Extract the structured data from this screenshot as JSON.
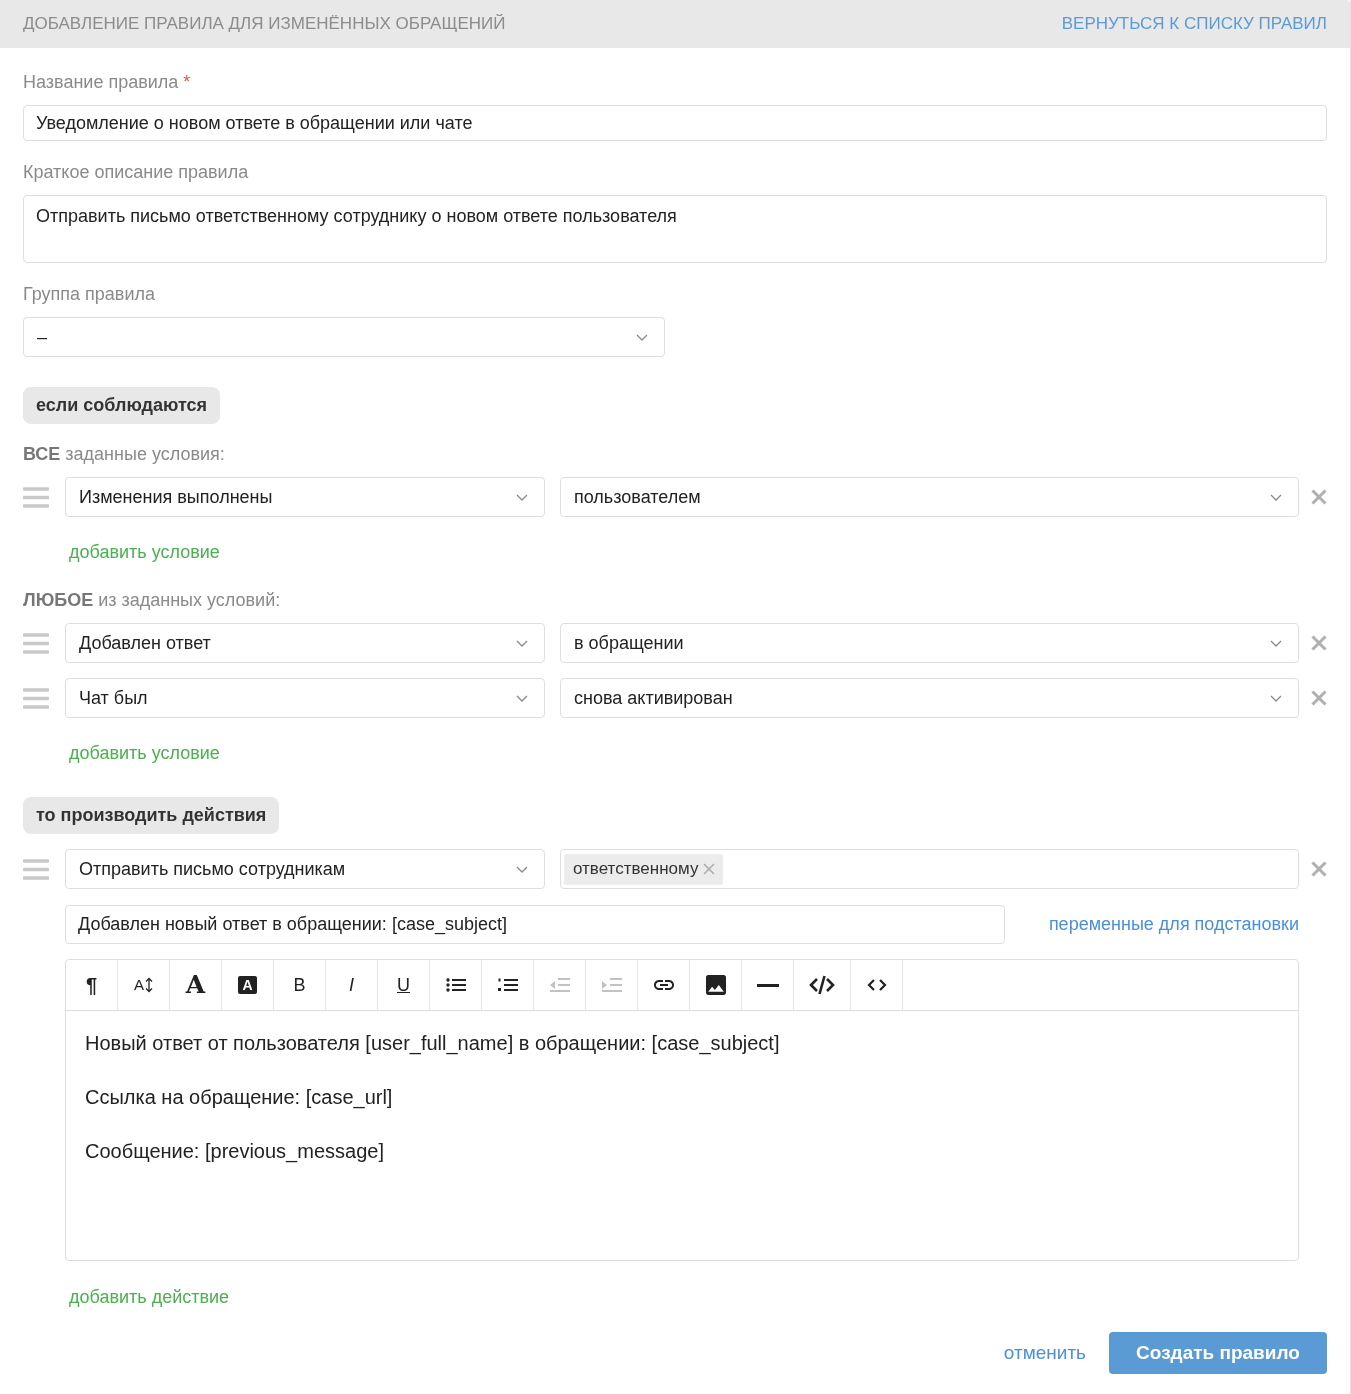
{
  "header": {
    "title": "ДОБАВЛЕНИЕ ПРАВИЛА ДЛЯ ИЗМЕНЁННЫХ ОБРАЩЕНИЙ",
    "back_link": "ВЕРНУТЬСЯ К СПИСКУ ПРАВИЛ"
  },
  "fields": [
    {
      "kind": "text",
      "label": "Название правила",
      "required_mark": "*",
      "value": "Уведомление о новом ответе в обращении или чате"
    },
    {
      "kind": "textarea",
      "label": "Краткое описание правила",
      "value": "Отправить письмо ответственному сотруднику о новом ответе пользователя"
    },
    {
      "kind": "select",
      "label": "Группа правила",
      "value": "–"
    }
  ],
  "conditions": {
    "section_label": "если соблюдаются",
    "groups": [
      {
        "heading": "**ВСЕ** заданные условия:",
        "rows": [
          {
            "field": "Изменения выполнены",
            "value": "пользователем"
          }
        ],
        "add_link": "добавить условие"
      },
      {
        "heading": "**ЛЮБОЕ** из заданных условий:",
        "rows": [
          {
            "field": "Добавлен ответ",
            "value": "в обращении"
          },
          {
            "field": "Чат был",
            "value": "снова активирован"
          }
        ],
        "add_link": "добавить условие"
      }
    ]
  },
  "actions": {
    "section_label": "то производить действия",
    "rows": [
      {
        "action": "Отправить письмо сотрудникам",
        "recipients": [
          {
            "label": "ответственному"
          }
        ],
        "subject": "Добавлен новый ответ в обращении: [case_subject]",
        "variables_link": "переменные для подстановки",
        "toolbar": [
          {
            "kind": "paragraph",
            "glyph": "¶",
            "disabled": false
          },
          {
            "kind": "font-size",
            "glyph": "A",
            "disabled": false
          },
          {
            "kind": "font",
            "glyph": "A",
            "disabled": false
          },
          {
            "kind": "highlight",
            "glyph": "A",
            "disabled": false
          },
          {
            "kind": "bold",
            "glyph": "B",
            "disabled": false
          },
          {
            "kind": "italic",
            "glyph": "I",
            "disabled": false
          },
          {
            "kind": "underline",
            "glyph": "U",
            "disabled": false
          },
          {
            "kind": "bulleted-list",
            "disabled": false
          },
          {
            "kind": "numbered-list",
            "disabled": false
          },
          {
            "kind": "outdent",
            "disabled": true
          },
          {
            "kind": "indent",
            "disabled": true
          },
          {
            "kind": "link",
            "disabled": false
          },
          {
            "kind": "image",
            "disabled": false
          },
          {
            "kind": "rule",
            "disabled": false
          },
          {
            "kind": "code",
            "disabled": false
          },
          {
            "kind": "html",
            "disabled": false
          }
        ],
        "body": [
          "Новый ответ от пользователя [user_full_name] в обращении: [case_subject]",
          "Ссылка на обращение: [case_url]",
          "Сообщение: [previous_message]"
        ]
      }
    ],
    "add_link": "добавить действие"
  },
  "footer": {
    "cancel": "отменить",
    "submit": "Создать правило"
  }
}
